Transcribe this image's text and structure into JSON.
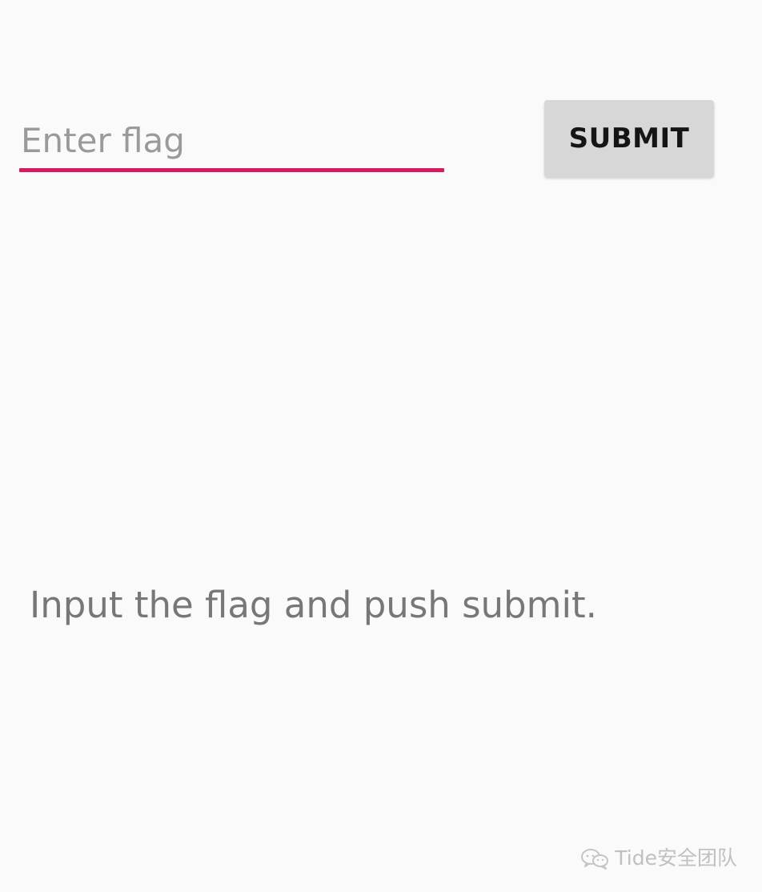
{
  "flag_input": {
    "placeholder": "Enter flag",
    "value": ""
  },
  "submit_button": {
    "label": "SUBMIT"
  },
  "status_message": "Input the flag and push submit.",
  "watermark": {
    "text": "Tide安全团队",
    "icon": "wechat-icon"
  },
  "colors": {
    "background": "#fafafa",
    "accent": "#d81b60",
    "button_background": "#d7d7d7",
    "button_text": "#151515",
    "message_text": "#777777",
    "placeholder_text": "#9a9a9a",
    "watermark_text": "#bdbdbd"
  }
}
